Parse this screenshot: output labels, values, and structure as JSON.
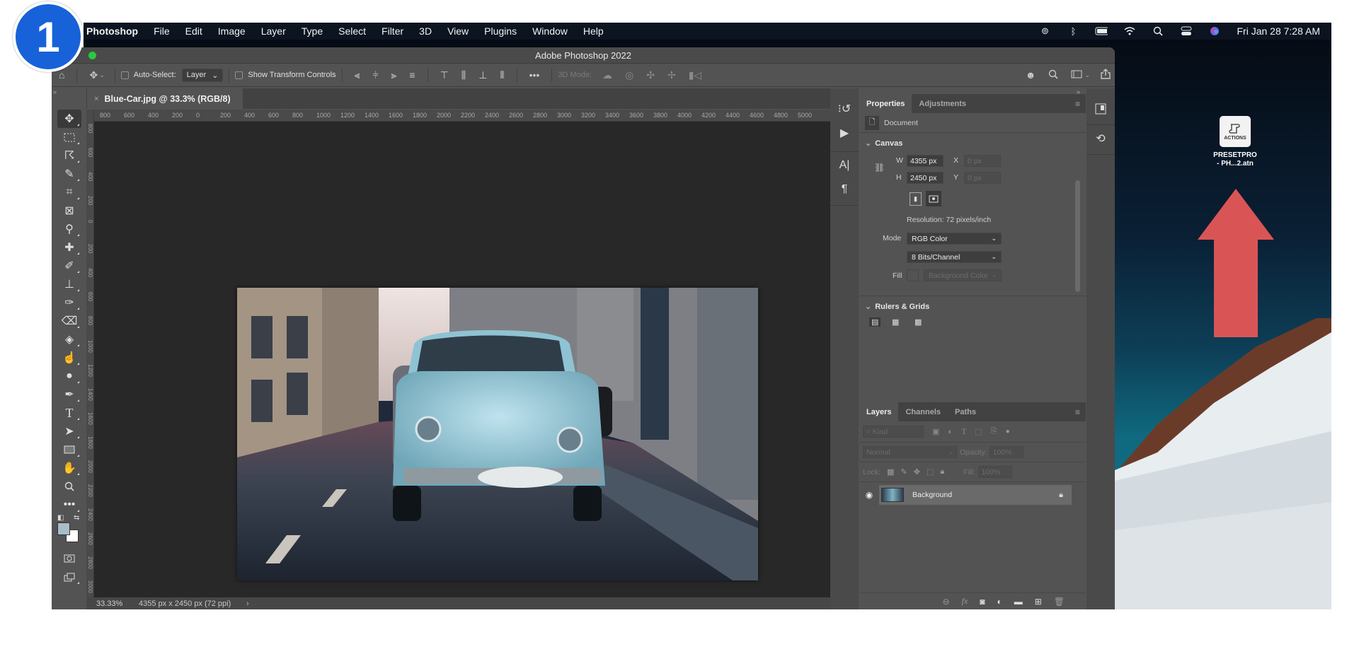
{
  "badge": {
    "number": "1"
  },
  "menubar": {
    "app": "Photoshop",
    "items": [
      "File",
      "Edit",
      "Image",
      "Layer",
      "Type",
      "Select",
      "Filter",
      "3D",
      "View",
      "Plugins",
      "Window",
      "Help"
    ],
    "status_icons": [
      "creative-cloud-icon",
      "bluetooth-icon",
      "battery-charging-icon",
      "wifi-icon",
      "spotlight-search-icon",
      "control-center-icon",
      "siri-icon"
    ],
    "clock": "Fri Jan 28  7:28 AM"
  },
  "window": {
    "title": "Adobe Photoshop 2022"
  },
  "options_bar": {
    "auto_select_label": "Auto-Select:",
    "auto_select_value": "Layer",
    "show_transform_label": "Show Transform Controls",
    "mode_3d_label": "3D Mode:"
  },
  "document": {
    "tab_title": "Blue-Car.jpg @ 33.3% (RGB/8)",
    "ruler_h": [
      "800",
      "600",
      "400",
      "200",
      "0",
      "200",
      "400",
      "600",
      "800",
      "1000",
      "1200",
      "1400",
      "1600",
      "1800",
      "2000",
      "2200",
      "2400",
      "2600",
      "2800",
      "3000",
      "3200",
      "3400",
      "3600",
      "3800",
      "4000",
      "4200",
      "4400",
      "4600",
      "4800",
      "5000"
    ],
    "ruler_v": [
      "800",
      "600",
      "400",
      "200",
      "0",
      "200",
      "400",
      "600",
      "800",
      "1000",
      "1200",
      "1400",
      "1600",
      "1800",
      "2000",
      "2200",
      "2400",
      "2600",
      "2800",
      "3000"
    ],
    "zoom": "33.33%",
    "info": "4355 px x 2450 px (72 ppi)"
  },
  "tools": [
    "move-tool",
    "marquee-tool",
    "lasso-tool",
    "quick-selection-tool",
    "crop-tool",
    "frame-tool",
    "eyedropper-tool",
    "healing-brush-tool",
    "brush-tool",
    "clone-stamp-tool",
    "history-brush-tool",
    "eraser-tool",
    "paint-bucket-tool",
    "smudge-tool",
    "dodge-tool",
    "pen-tool",
    "type-tool",
    "path-selection-tool",
    "rectangle-tool",
    "hand-tool",
    "zoom-tool",
    "edit-toolbar"
  ],
  "colors": {
    "foreground": "#a9bcc9",
    "background": "#ffffff",
    "accent_badge": "#1762d8",
    "arrow": "#d95555"
  },
  "properties": {
    "tabs": [
      "Properties",
      "Adjustments"
    ],
    "active_tab": "Properties",
    "kind": "Document",
    "canvas_section": "Canvas",
    "w_label": "W",
    "w_value": "4355 px",
    "h_label": "H",
    "h_value": "2450 px",
    "x_label": "X",
    "x_value": "0 px",
    "y_label": "Y",
    "y_value": "0 px",
    "resolution": "Resolution: 72 pixels/inch",
    "mode_label": "Mode",
    "mode_value": "RGB Color",
    "bits_value": "8 Bits/Channel",
    "fill_label": "Fill",
    "fill_value": "Background Color",
    "rulers_section": "Rulers & Grids"
  },
  "layers": {
    "tabs": [
      "Layers",
      "Channels",
      "Paths"
    ],
    "active_tab": "Layers",
    "filter_placeholder": "Kind",
    "blend_mode": "Normal",
    "opacity_label": "Opacity:",
    "opacity_value": "100%",
    "lock_label": "Lock:",
    "fill_label": "Fill:",
    "fill_value": "100%",
    "items": [
      {
        "name": "Background",
        "visible": true,
        "locked": true
      }
    ]
  },
  "desktop": {
    "file_icon_label": "ACTIONS",
    "file_name_line1": "PRESETPRO",
    "file_name_line2": "- PH...2.atn"
  }
}
